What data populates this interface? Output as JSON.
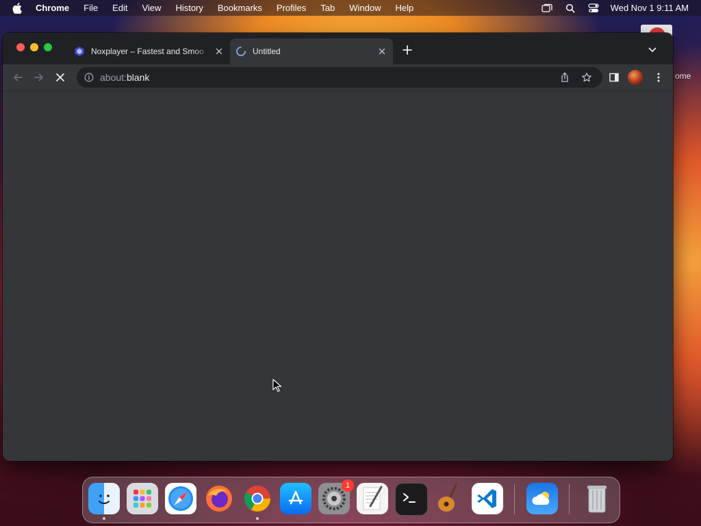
{
  "menubar": {
    "app_name": "Chrome",
    "items": [
      "File",
      "Edit",
      "View",
      "History",
      "Bookmarks",
      "Profiles",
      "Tab",
      "Window",
      "Help"
    ],
    "clock": "Wed Nov 1  9:11 AM"
  },
  "desktop": {
    "partial_label": "ome"
  },
  "browser": {
    "tabs": [
      {
        "title": "Noxplayer – Fastest and Smoo",
        "active": false,
        "favicon": "noxplayer-icon"
      },
      {
        "title": "Untitled",
        "active": true,
        "favicon": "loading-spinner-icon"
      }
    ],
    "address": {
      "scheme": "about:",
      "host": "blank"
    }
  },
  "dock": {
    "apps": [
      "Finder",
      "Launchpad",
      "Safari",
      "Firefox",
      "Google Chrome",
      "App Store",
      "System Settings",
      "TextEdit",
      "Terminal",
      "GarageBand",
      "Visual Studio Code",
      "Weather",
      "Trash"
    ],
    "system_settings_badge": "1"
  },
  "colors": {
    "tabstrip": "#202124",
    "toolbar": "#35363a",
    "omnibox": "#202124",
    "page_background": "#35363a"
  }
}
